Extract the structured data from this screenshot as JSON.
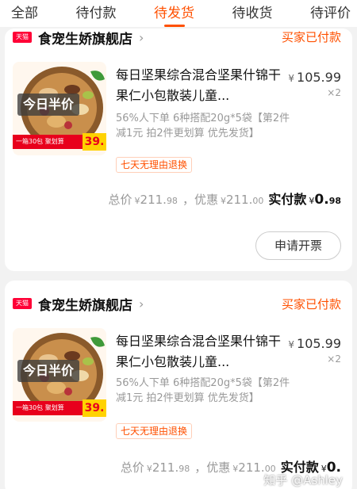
{
  "tabs": [
    {
      "label": "全部"
    },
    {
      "label": "待付款"
    },
    {
      "label": "待发货"
    },
    {
      "label": "待收货"
    },
    {
      "label": "待评价"
    }
  ],
  "active_tab": 2,
  "accent_color": "#ff5000",
  "orders": [
    {
      "shop_badge": "天猫",
      "shop_name": "食宠生娇旗舰店",
      "status": "买家已付款",
      "thumb_promo": "今日半价",
      "thumb_strip": "一箱30包 聚划算",
      "thumb_price": "39.",
      "title": "每日坚果综合混合坚果什锦干果仁小包散装儿童...",
      "price_symbol": "¥",
      "price": "105.99",
      "quantity": "×2",
      "sku": "56%人下单 6种搭配20g*5袋【第2件减1元 拍2件更划算 优先发货】",
      "guarantee": "七天无理由退换",
      "total_label": "总价",
      "total_int": "211.",
      "total_dec": "98",
      "discount_label": "优惠",
      "discount_int": "211.",
      "discount_dec": "00",
      "paid_label": "实付款",
      "paid_int": "0.",
      "paid_dec": "98",
      "invoice_button": "申请开票"
    },
    {
      "shop_badge": "天猫",
      "shop_name": "食宠生娇旗舰店",
      "status": "买家已付款",
      "thumb_promo": "今日半价",
      "thumb_strip": "一箱30包 聚划算",
      "thumb_price": "39.",
      "title": "每日坚果综合混合坚果什锦干果仁小包散装儿童...",
      "price_symbol": "¥",
      "price": "105.99",
      "quantity": "×2",
      "sku": "56%人下单 6种搭配20g*5袋【第2件减1元 拍2件更划算 优先发货】",
      "guarantee": "七天无理由退换",
      "total_label": "总价",
      "total_int": "211.",
      "total_dec": "98",
      "discount_label": "优惠",
      "discount_int": "211.",
      "discount_dec": "00",
      "paid_label": "实付款",
      "paid_int": "0.",
      "paid_dec": "",
      "watermark": "知乎 @Ashley"
    }
  ]
}
